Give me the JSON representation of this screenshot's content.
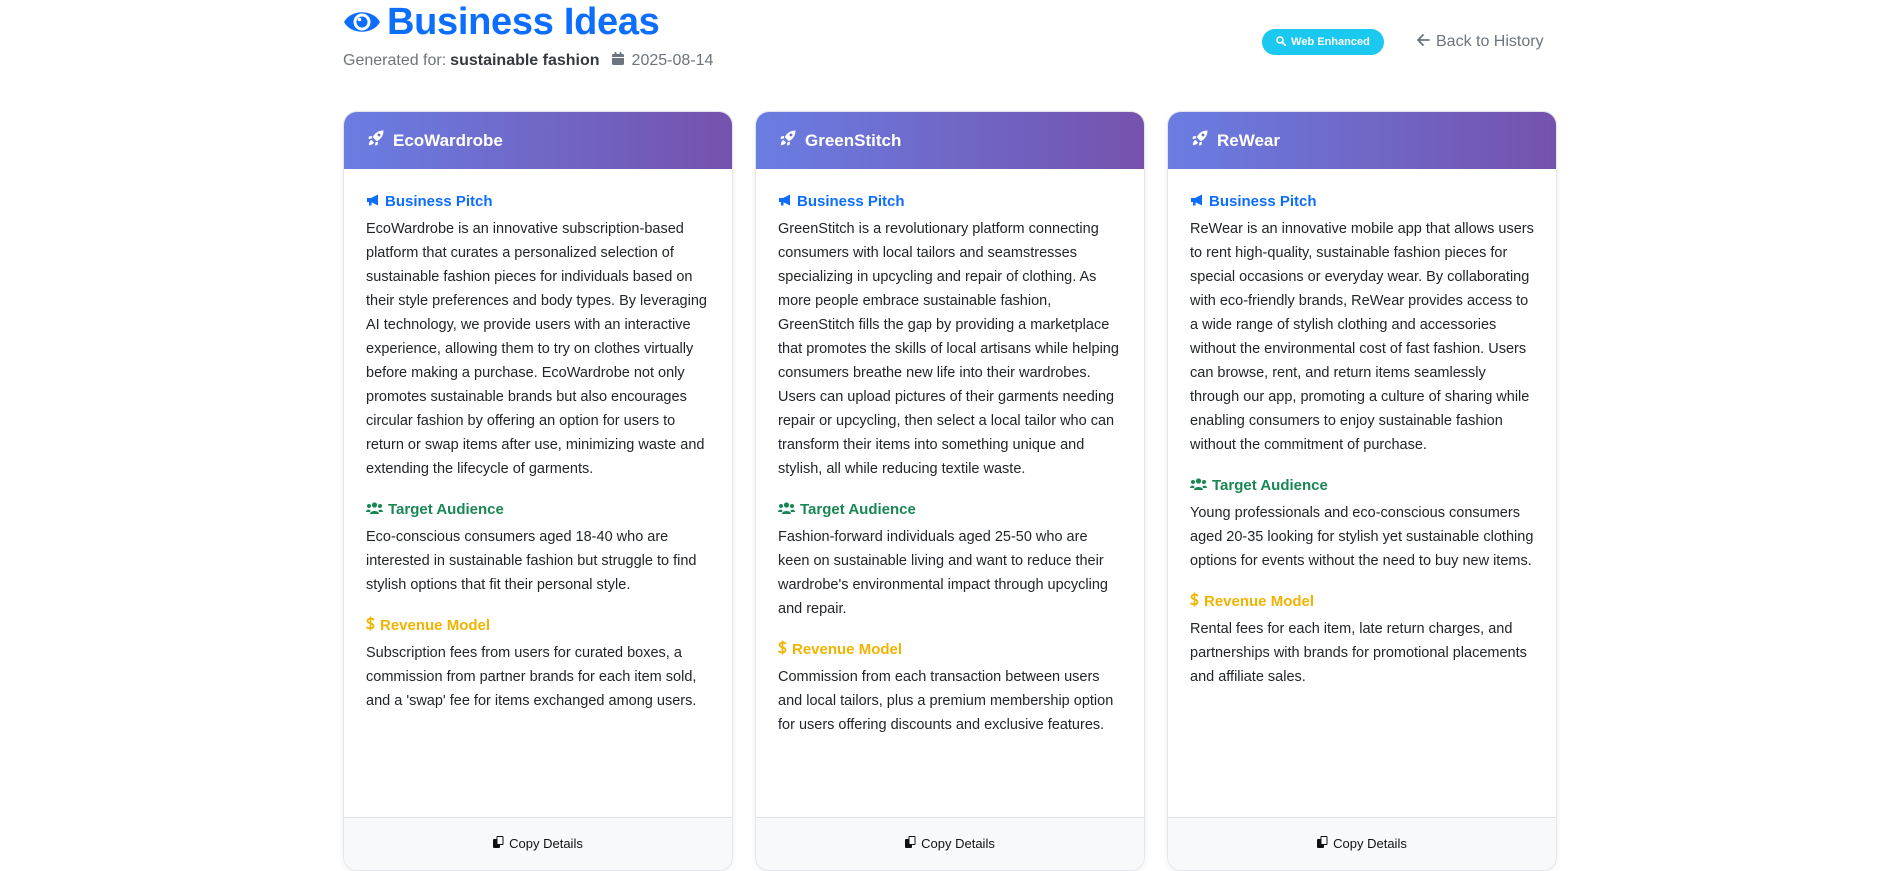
{
  "header": {
    "title": "Business Ideas",
    "generated_for_label": "Generated for:",
    "topic": "sustainable fashion",
    "date": "2025-08-14",
    "badge": "Web Enhanced",
    "back_link": "Back to History"
  },
  "colors": {
    "primary": "#0d6efd",
    "badge": "#1bc8f0",
    "audience": "#198754",
    "revenue": "#f0b400",
    "header_gradient_start": "#6a7de2",
    "header_gradient_end": "#7552ad"
  },
  "section_labels": {
    "pitch": "Business Pitch",
    "audience": "Target Audience",
    "revenue": "Revenue Model",
    "copy": "Copy Details"
  },
  "icons": {
    "title": "eye-icon",
    "calendar": "calendar-icon",
    "badge": "search-icon",
    "back": "arrow-left-icon",
    "card_header": "rocket-icon",
    "pitch": "megaphone-icon",
    "audience": "users-icon",
    "revenue": "dollar-icon",
    "copy": "copy-icon"
  },
  "cards": [
    {
      "name": "EcoWardrobe",
      "pitch": "EcoWardrobe is an innovative subscription-based platform that curates a personalized selection of sustainable fashion pieces for individuals based on their style preferences and body types. By leveraging AI technology, we provide users with an interactive experience, allowing them to try on clothes virtually before making a purchase. EcoWardrobe not only promotes sustainable brands but also encourages circular fashion by offering an option for users to return or swap items after use, minimizing waste and extending the lifecycle of garments.",
      "audience": "Eco-conscious consumers aged 18-40 who are interested in sustainable fashion but struggle to find stylish options that fit their personal style.",
      "revenue": "Subscription fees from users for curated boxes, a commission from partner brands for each item sold, and a 'swap' fee for items exchanged among users."
    },
    {
      "name": "GreenStitch",
      "pitch": "GreenStitch is a revolutionary platform connecting consumers with local tailors and seamstresses specializing in upcycling and repair of clothing. As more people embrace sustainable fashion, GreenStitch fills the gap by providing a marketplace that promotes the skills of local artisans while helping consumers breathe new life into their wardrobes. Users can upload pictures of their garments needing repair or upcycling, then select a local tailor who can transform their items into something unique and stylish, all while reducing textile waste.",
      "audience": "Fashion-forward individuals aged 25-50 who are keen on sustainable living and want to reduce their wardrobe's environmental impact through upcycling and repair.",
      "revenue": "Commission from each transaction between users and local tailors, plus a premium membership option for users offering discounts and exclusive features."
    },
    {
      "name": "ReWear",
      "pitch": "ReWear is an innovative mobile app that allows users to rent high-quality, sustainable fashion pieces for special occasions or everyday wear. By collaborating with eco-friendly brands, ReWear provides access to a wide range of stylish clothing and accessories without the environmental cost of fast fashion. Users can browse, rent, and return items seamlessly through our app, promoting a culture of sharing while enabling consumers to enjoy sustainable fashion without the commitment of purchase.",
      "audience": "Young professionals and eco-conscious consumers aged 20-35 looking for stylish yet sustainable clothing options for events without the need to buy new items.",
      "revenue": "Rental fees for each item, late return charges, and partnerships with brands for promotional placements and affiliate sales."
    }
  ]
}
